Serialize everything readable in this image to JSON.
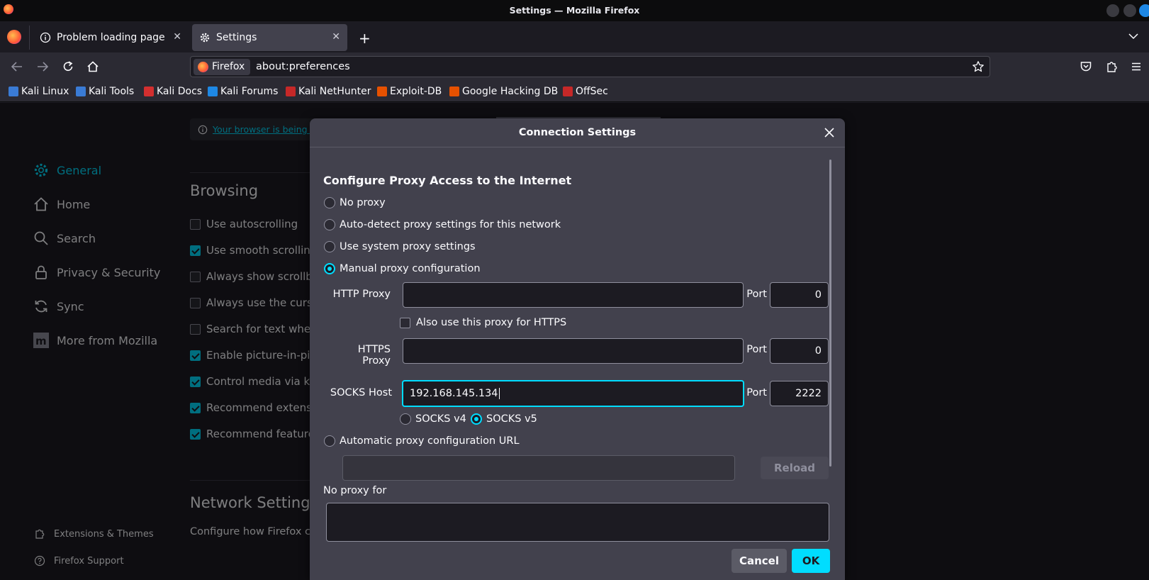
{
  "window": {
    "title": "Settings — Mozilla Firefox"
  },
  "tabs": [
    {
      "label": "Problem loading page",
      "icon": "info-icon"
    },
    {
      "label": "Settings",
      "icon": "gear-icon"
    }
  ],
  "urlbar": {
    "identity": "Firefox",
    "url": "about:preferences"
  },
  "bookmarks": [
    {
      "label": "Kali Linux",
      "color": "#1f78d1"
    },
    {
      "label": "Kali Tools",
      "color": "#3a7bd5"
    },
    {
      "label": "Kali Docs",
      "color": "#d32f2f"
    },
    {
      "label": "Kali Forums",
      "color": "#1e88e5"
    },
    {
      "label": "Kali NetHunter",
      "color": "#c62828"
    },
    {
      "label": "Exploit-DB",
      "color": "#e65100"
    },
    {
      "label": "Google Hacking DB",
      "color": "#e65100"
    },
    {
      "label": "OffSec",
      "color": "#c62828"
    }
  ],
  "sidebar": {
    "items": [
      {
        "label": "General",
        "icon": "gear-icon",
        "selected": true
      },
      {
        "label": "Home",
        "icon": "home-icon"
      },
      {
        "label": "Search",
        "icon": "search-icon"
      },
      {
        "label": "Privacy & Security",
        "icon": "lock-icon"
      },
      {
        "label": "Sync",
        "icon": "sync-icon"
      },
      {
        "label": "More from Mozilla",
        "icon": "mozilla-icon"
      }
    ],
    "footer": [
      {
        "label": "Extensions & Themes",
        "icon": "puzzle-icon"
      },
      {
        "label": "Firefox Support",
        "icon": "help-icon"
      }
    ]
  },
  "prefs": {
    "notice": "Your browser is being m",
    "browsing_heading": "Browsing",
    "checks": [
      {
        "label": "Use autoscrolling",
        "checked": false
      },
      {
        "label": "Use smooth scrolling",
        "checked": true
      },
      {
        "label": "Always show scrollbar",
        "checked": false
      },
      {
        "label": "Always use the cursor",
        "checked": false
      },
      {
        "label": "Search for text when y",
        "checked": false
      },
      {
        "label": "Enable picture-in-pictu",
        "checked": true
      },
      {
        "label": "Control media via keyb",
        "checked": true
      },
      {
        "label": "Recommend extension",
        "checked": true
      },
      {
        "label": "Recommend features a",
        "checked": true
      }
    ],
    "network_heading": "Network Settings",
    "network_desc": "Configure how Firefox co"
  },
  "dialog": {
    "title": "Connection Settings",
    "section": "Configure Proxy Access to the Internet",
    "options": {
      "no_proxy": "No proxy",
      "auto_detect": "Auto-detect proxy settings for this network",
      "system": "Use system proxy settings",
      "manual": "Manual proxy configuration",
      "pac": "Automatic proxy configuration URL"
    },
    "selected_option": "manual",
    "http_label": "HTTP Proxy",
    "http_value": "",
    "http_port": "0",
    "also_https_label": "Also use this proxy for HTTPS",
    "also_https_checked": false,
    "https_label": "HTTPS Proxy",
    "https_value": "",
    "https_port": "0",
    "socks_label": "SOCKS Host",
    "socks_value": "192.168.145.134",
    "socks_port": "2222",
    "port_label": "Port",
    "socks_v4": "SOCKS v4",
    "socks_v5": "SOCKS v5",
    "socks_version": "v5",
    "pac_value": "",
    "reload_label": "Reload",
    "no_proxy_for_label": "No proxy for",
    "no_proxy_for_value": "",
    "cancel_label": "Cancel",
    "ok_label": "OK"
  },
  "colors": {
    "accent": "#00ddff",
    "dialog_bg": "#42414d",
    "page_bg": "#1c1b22",
    "toolbar_bg": "#2b2a33"
  }
}
